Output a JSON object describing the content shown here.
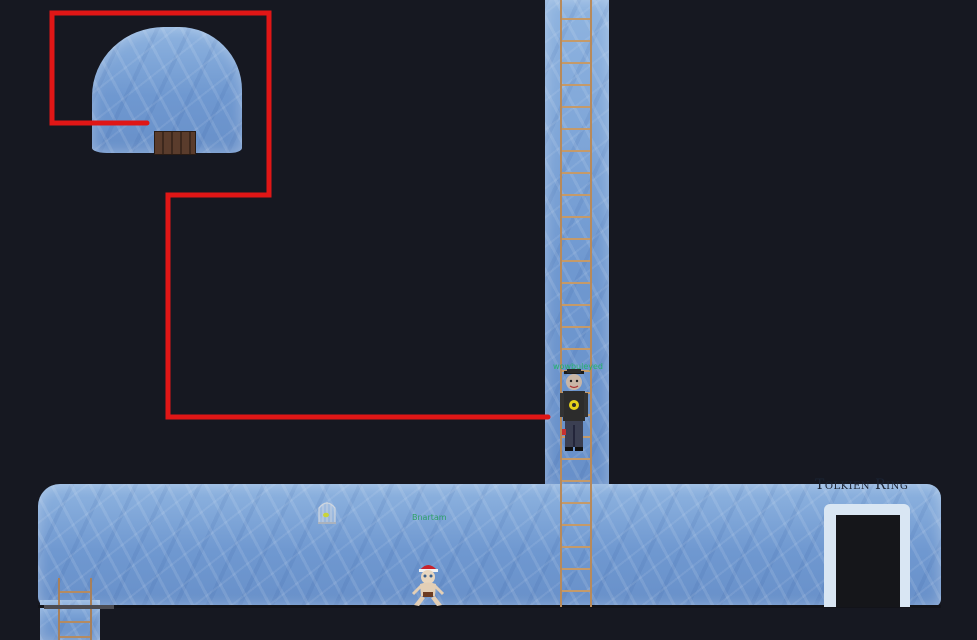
{
  "scene": {
    "location_sign": "Tolkien Ring",
    "player": {
      "username": "wowbuleyed",
      "avatar": "elf-avatar-hat-jacket"
    },
    "npc": {
      "username": "Bnartam",
      "character": "gollum-santa-hat"
    },
    "props": [
      "ice-cave",
      "wooden-door",
      "ladder-main",
      "ladder-small",
      "bird-cage",
      "ring-door"
    ],
    "route_color": "#e01616",
    "ice_color": "#7aa2d6",
    "background_color": "#161821"
  }
}
